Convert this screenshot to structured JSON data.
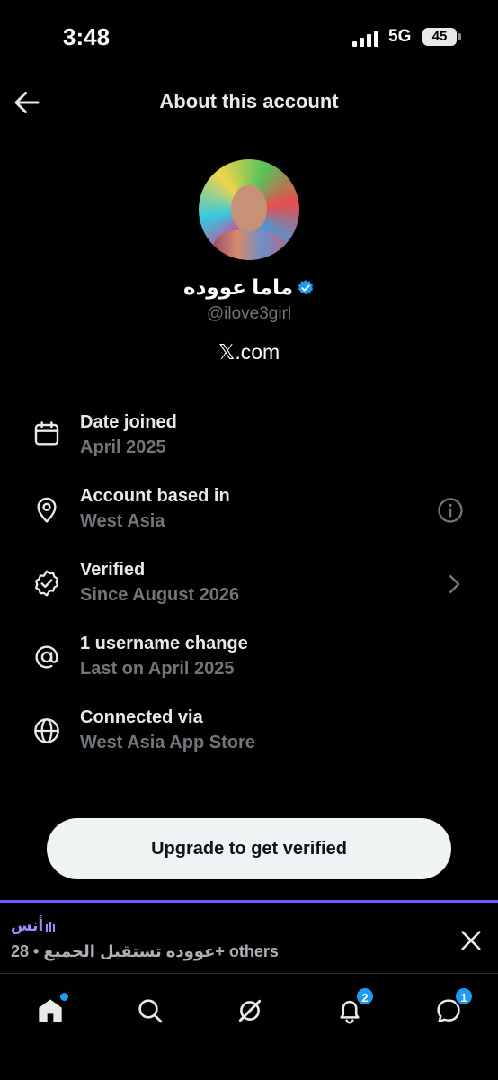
{
  "status_bar": {
    "time": "3:48",
    "network": "5G",
    "battery": "45"
  },
  "header": {
    "title": "About this account"
  },
  "profile": {
    "display_name": "ماما عووده",
    "handle": "@ilove3girl",
    "site": "𝕏.com",
    "verified": true,
    "verified_color": "#1d9bf0"
  },
  "info_rows": [
    {
      "icon": "calendar-icon",
      "title": "Date joined",
      "subtitle": "April 2025"
    },
    {
      "icon": "location-pin-icon",
      "title": "Account based in",
      "subtitle": "West Asia",
      "action": "info-icon"
    },
    {
      "icon": "verified-outline-icon",
      "title": "Verified",
      "subtitle": "Since August 2026",
      "action": "chevron-right-icon"
    },
    {
      "icon": "at-sign-icon",
      "title": "1 username change",
      "subtitle": "Last on April 2025"
    },
    {
      "icon": "globe-icon",
      "title": "Connected via",
      "subtitle": "West Asia App Store"
    }
  ],
  "upgrade_button": {
    "label": "Upgrade to get verified"
  },
  "space_bar": {
    "host": "أنس",
    "description": "عووده تستقبل الجميع • 28+ others",
    "accent_color": "#7856ff"
  },
  "bottom_nav": {
    "items": [
      {
        "icon": "home-icon",
        "has_dot": true
      },
      {
        "icon": "search-icon"
      },
      {
        "icon": "grok-icon"
      },
      {
        "icon": "bell-icon",
        "badge": "2"
      },
      {
        "icon": "messages-icon",
        "badge": "1"
      }
    ]
  }
}
